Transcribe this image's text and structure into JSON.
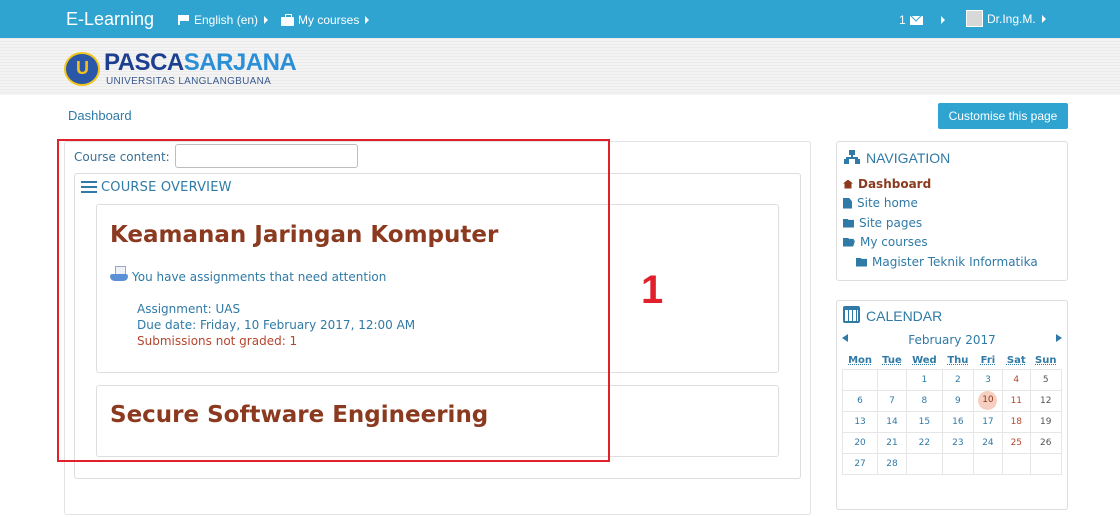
{
  "navbar": {
    "brand": "E-Learning",
    "language": "English (en)",
    "my_courses": "My courses",
    "messages_count": "1",
    "user": "Dr.Ing.M."
  },
  "logo": {
    "word_part1": "PASCA",
    "word_part2": "SARJANA",
    "subtitle": "UNIVERSITAS LANGLANGBUANA"
  },
  "breadcrumb": "Dashboard",
  "customise_button": "Customise this page",
  "main": {
    "course_content_label": "Course content:",
    "course_content_value": "",
    "overview_title": "COURSE OVERVIEW",
    "courses": [
      {
        "title": "Keamanan Jaringan Komputer",
        "alert": "You have assignments that need attention",
        "assignment": "Assignment: UAS",
        "due": "Due date: Friday, 10 February 2017, 12:00 AM",
        "submissions": "Submissions not graded: 1"
      },
      {
        "title": "Secure Software Engineering"
      }
    ]
  },
  "annotation": {
    "number": "1"
  },
  "navigation": {
    "title": "NAVIGATION",
    "items": [
      {
        "label": "Dashboard",
        "icon": "home-icon"
      },
      {
        "label": "Site home",
        "icon": "file-icon"
      },
      {
        "label": "Site pages",
        "icon": "folder-icon"
      },
      {
        "label": "My courses",
        "icon": "folder-open-icon"
      },
      {
        "label": "Magister Teknik Informatika",
        "icon": "folder-icon"
      }
    ]
  },
  "calendar": {
    "title": "CALENDAR",
    "month": "February 2017",
    "weekdays": [
      "Mon",
      "Tue",
      "Wed",
      "Thu",
      "Fri",
      "Sat",
      "Sun"
    ],
    "weeks": [
      [
        "",
        "",
        "1",
        "2",
        "3",
        "4",
        "5"
      ],
      [
        "6",
        "7",
        "8",
        "9",
        "10",
        "11",
        "12"
      ],
      [
        "13",
        "14",
        "15",
        "16",
        "17",
        "18",
        "19"
      ],
      [
        "20",
        "21",
        "22",
        "23",
        "24",
        "25",
        "26"
      ],
      [
        "27",
        "28",
        "",
        "",
        "",
        "",
        ""
      ]
    ],
    "today": "10"
  },
  "colors": {
    "navbar": "#2fa4d1",
    "link": "#2f7aa6",
    "course_title": "#8b3a1f",
    "annotation": "#e0202a"
  }
}
